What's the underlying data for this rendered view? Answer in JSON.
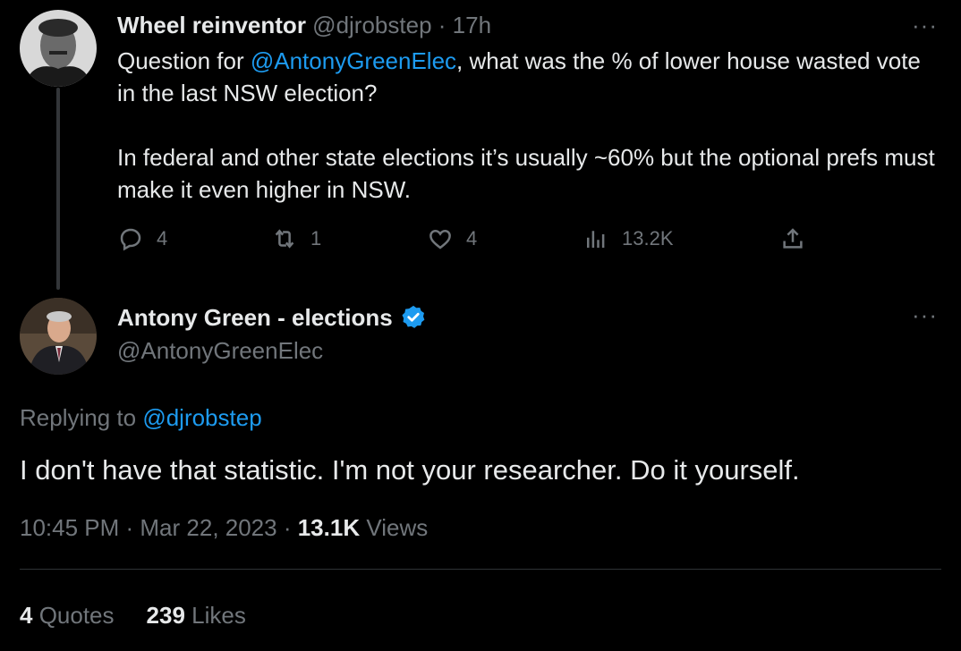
{
  "tweet1": {
    "name": "Wheel reinventor",
    "handle": "@djrobstep",
    "separator": "·",
    "time": "17h",
    "more": "···",
    "body_prefix": "Question for ",
    "mention": "@AntonyGreenElec",
    "body_suffix": ", what was the % of lower house wasted vote in the last NSW election?",
    "body_para2": "In federal and other state elections it’s usually ~60% but the optional prefs must make it even higher in NSW.",
    "actions": {
      "replies": "4",
      "retweets": "1",
      "likes": "4",
      "views": "13.2K"
    }
  },
  "tweet2": {
    "name": "Antony Green - elections",
    "handle": "@AntonyGreenElec",
    "more": "···",
    "replying_label": "Replying to ",
    "replying_to": "@djrobstep",
    "text": "I don't have that statistic. I'm not your researcher. Do it yourself.",
    "timestamp": "10:45 PM · Mar 22, 2023 · ",
    "views_count": "13.1K",
    "views_label": " Views",
    "quotes_count": "4",
    "quotes_label": " Quotes",
    "likes_count": "239",
    "likes_label": " Likes"
  },
  "colors": {
    "background": "#000000",
    "text": "#e7e9ea",
    "muted": "#71767b",
    "accent": "#1d9bf0"
  },
  "icons": [
    "reply-icon",
    "retweet-icon",
    "like-icon",
    "views-icon",
    "share-icon",
    "verified-badge-icon",
    "more-icon"
  ]
}
